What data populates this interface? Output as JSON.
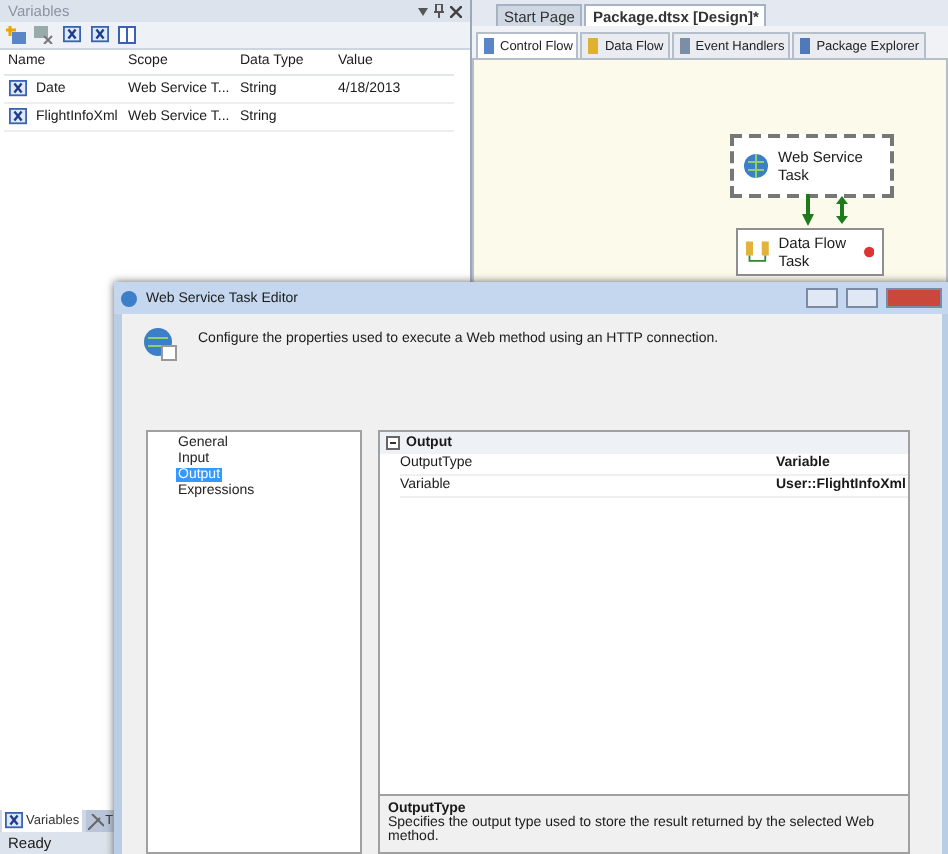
{
  "variables_panel": {
    "title": "Variables",
    "columns": [
      "Name",
      "Scope",
      "Data Type",
      "Value"
    ],
    "rows": [
      {
        "name": "Date",
        "scope": "Web Service T...",
        "data_type": "String",
        "value": "4/18/2013"
      },
      {
        "name": "FlightInfoXml",
        "scope": "Web Service T...",
        "data_type": "String"
      }
    ],
    "bottom_tabs": [
      {
        "label": "Variables",
        "selected": true
      },
      {
        "label": "T",
        "selected": false
      }
    ]
  },
  "status_bar": "Ready",
  "document_tabs": [
    {
      "label": "Start Page",
      "selected": false
    },
    {
      "label": "Package.dtsx [Design]*",
      "selected": true
    }
  ],
  "designer_tabs": [
    {
      "label": "Control Flow",
      "selected": true
    },
    {
      "label": "Data Flow",
      "selected": false
    },
    {
      "label": "Event Handlers",
      "selected": false
    },
    {
      "label": "Package Explorer",
      "selected": false
    }
  ],
  "tasks": [
    {
      "label": "Web Service Task",
      "kind": "web",
      "selected": true,
      "error": false
    },
    {
      "label": "Data Flow Task",
      "kind": "dataflow",
      "selected": false,
      "error": true
    }
  ],
  "dialog": {
    "title": "Web Service Task Editor",
    "description": "Configure the properties used to execute a Web method using an HTTP connection.",
    "pages": [
      {
        "label": "General",
        "selected": false
      },
      {
        "label": "Input",
        "selected": false
      },
      {
        "label": "Output",
        "selected": true
      },
      {
        "label": "Expressions",
        "selected": false
      }
    ],
    "category": {
      "label": "Output",
      "expanded": true
    },
    "properties": [
      {
        "name": "OutputType",
        "value": "Variable"
      },
      {
        "name": "Variable",
        "value": "User::FlightInfoXml"
      }
    ],
    "help_title": "OutputType",
    "help_text": "Specifies the output type used to store the result returned by the selected Web method."
  }
}
